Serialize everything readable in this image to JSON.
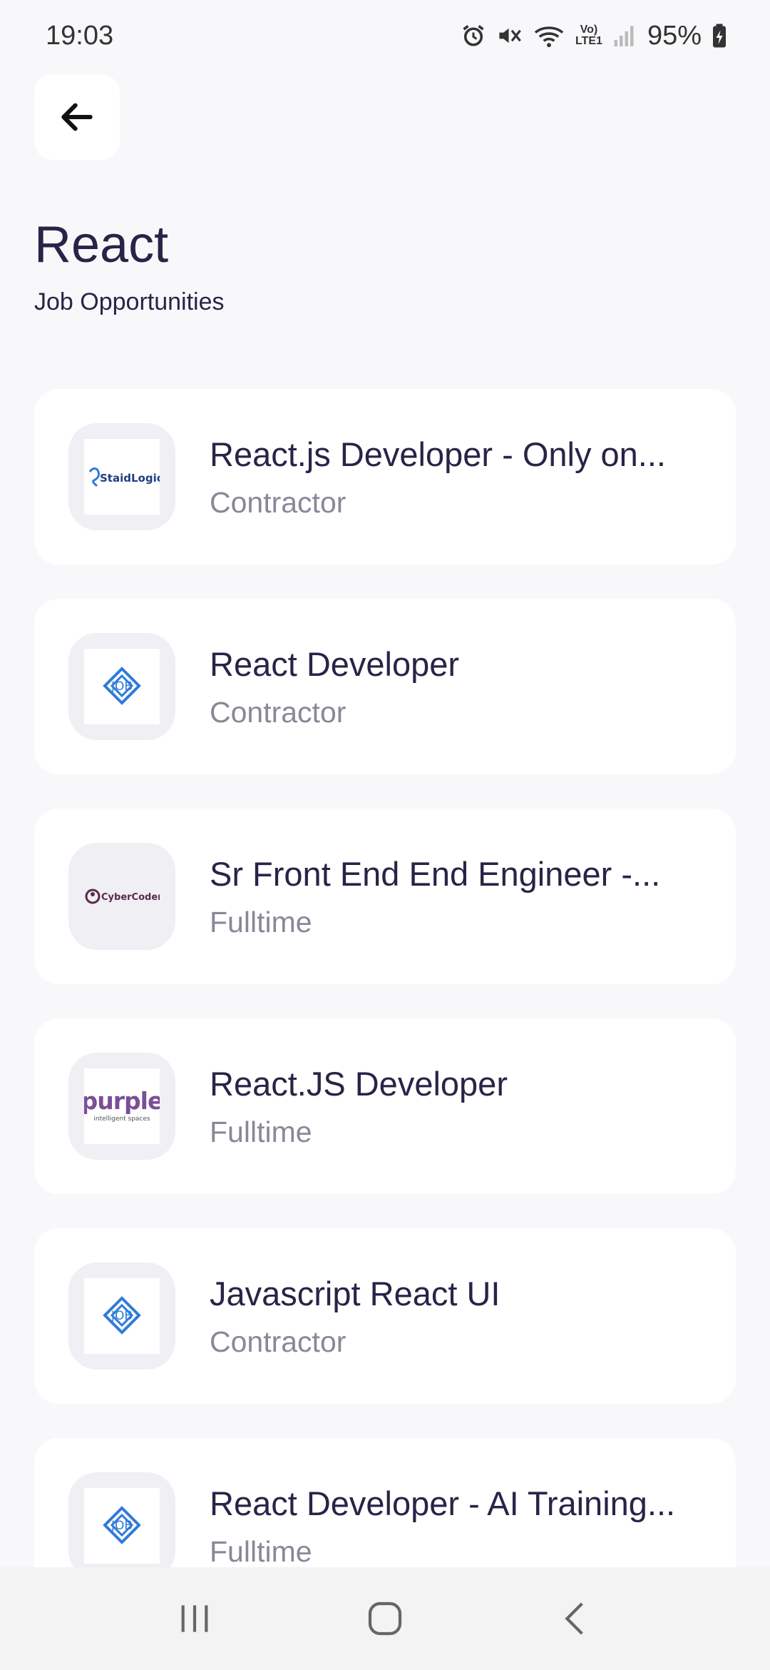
{
  "status_bar": {
    "time": "19:03",
    "network": "Vo) LTE1",
    "battery": "95%",
    "icons": [
      "alarm-icon",
      "mute-icon",
      "wifi-icon",
      "lte-icon",
      "signal-icon",
      "battery-icon"
    ]
  },
  "header": {
    "back_icon": "arrow-left-icon",
    "title": "React",
    "subtitle": "Job Opportunities"
  },
  "jobs": [
    {
      "title": "React.js Developer - Only on...",
      "type": "Contractor",
      "logo": "staidlogic-logo",
      "logo_text": "StaidLogic"
    },
    {
      "title": "React Developer",
      "type": "Contractor",
      "logo": "job-logo",
      "logo_text": "JOB"
    },
    {
      "title": "Sr Front End End Engineer -...",
      "type": "Fulltime",
      "logo": "cybercoders-logo",
      "logo_text": "CyberCoders"
    },
    {
      "title": "React.JS Developer",
      "type": "Fulltime",
      "logo": "purple-logo",
      "logo_text": "purple",
      "logo_subtext": "intelligent spaces"
    },
    {
      "title": "Javascript React UI",
      "type": "Contractor",
      "logo": "job-logo",
      "logo_text": "JOB"
    },
    {
      "title": "React Developer - AI Training...",
      "type": "Fulltime",
      "logo": "job-logo",
      "logo_text": "JOB"
    }
  ],
  "nav_bar": {
    "icons": [
      "recent-apps-icon",
      "home-icon",
      "back-icon"
    ]
  },
  "colors": {
    "background": "#F8F8FB",
    "card": "#FFFFFF",
    "title_text": "#2A2347",
    "secondary_text": "#8A8798",
    "logo_bg": "#EFEFF4",
    "job_logo_blue": "#2F7BD8",
    "purple_logo": "#7B4E96"
  }
}
